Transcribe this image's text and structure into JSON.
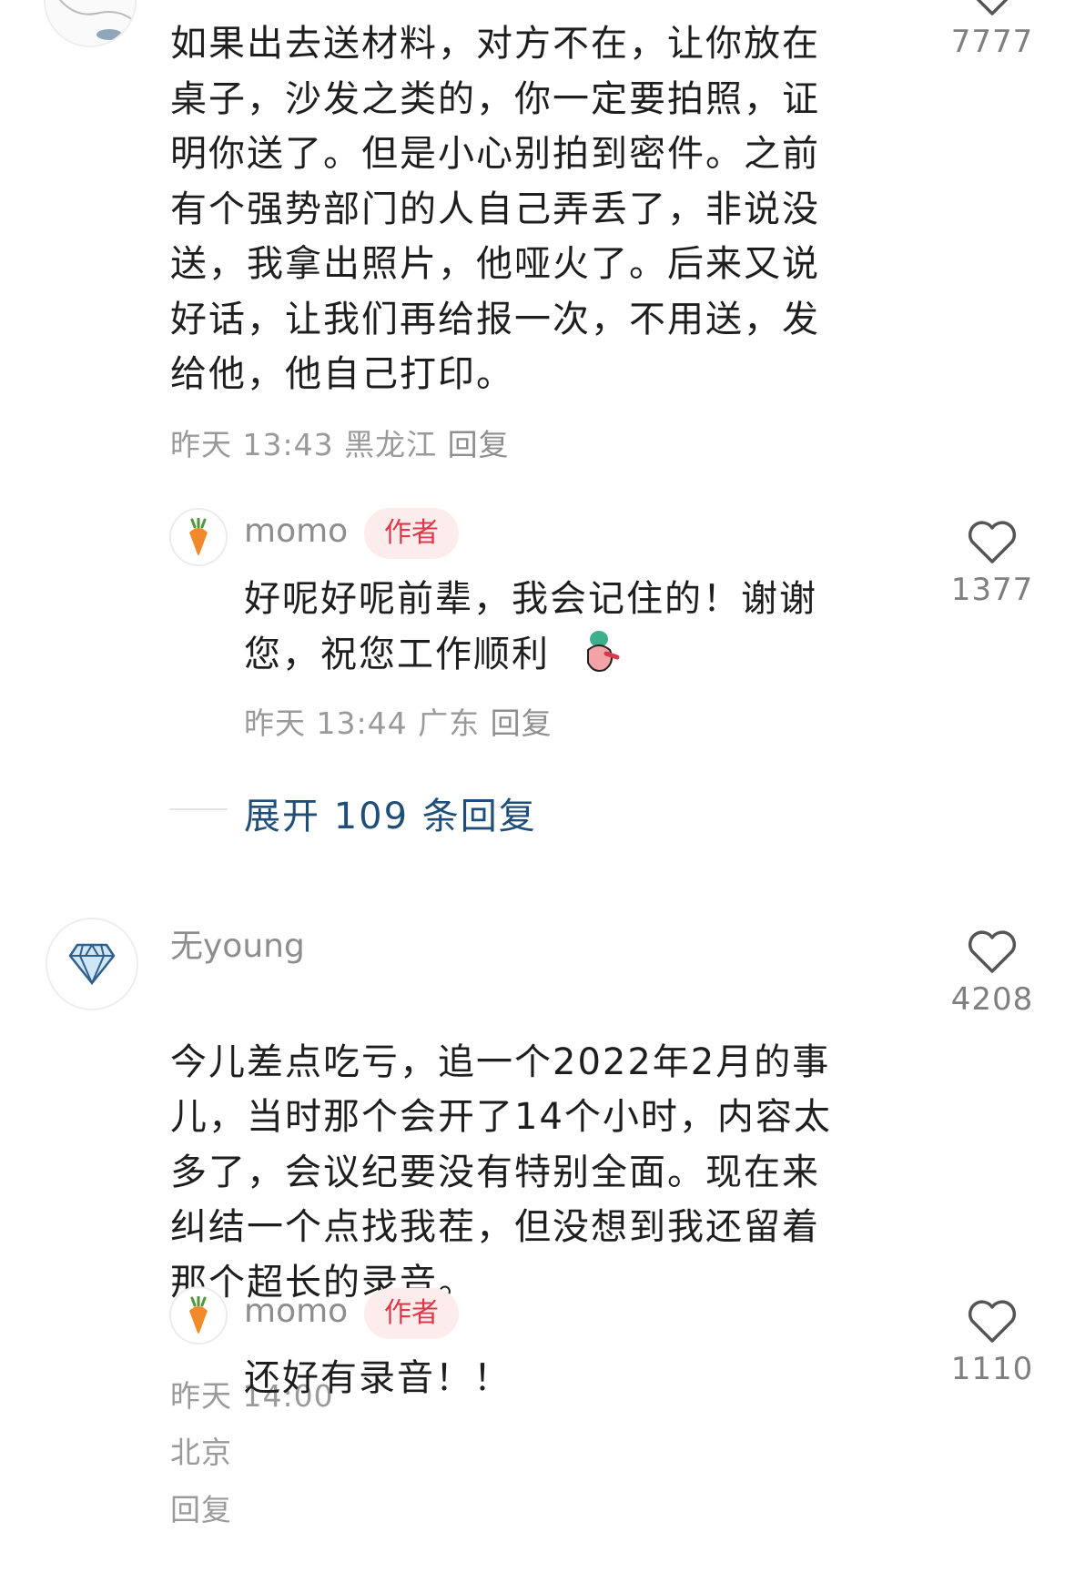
{
  "comment1": {
    "text": "如果出去送材料，对方不在，让你放在\n桌子，沙发之类的，你一定要拍照，证\n明你送了。但是小心别拍到密件。之前\n有个强势部门的人自己弄丢了，非说没\n送，我拿出照片，他哑火了。后来又说\n好话，让我们再给报一次，不用送，发\n给他，他自己打印。",
    "time": "昨天 13:43",
    "location": "黑龙江",
    "reply_label": "回复",
    "likes": "7777"
  },
  "reply1": {
    "username": "momo",
    "badge": "作者",
    "text": "好呢好呢前辈，我会记住的！谢谢\n您，祝您工作顺利",
    "time": "昨天 13:44",
    "location": "广东",
    "reply_label": "回复",
    "likes": "1377"
  },
  "expand": {
    "label": "展开 109 条回复"
  },
  "comment2": {
    "username": "无young",
    "text": "今儿差点吃亏，追一个2022年2月的事\n儿，当时那个会开了14个小时，内容太\n多了，会议纪要没有特别全面。现在来\n纠结一个点找我茬，但没想到我还留着\n那个超长的录音。",
    "time": "昨天 14:00",
    "location": "北京",
    "reply_label": "回复",
    "likes": "4208"
  },
  "reply2": {
    "username": "momo",
    "badge": "作者",
    "text": "还好有录音！！",
    "likes": "1110"
  },
  "colors": {
    "author_badge": "#e0384a",
    "expand_link": "#1f4e79"
  },
  "icons": [
    "heart-outline-icon",
    "carrot-avatar",
    "diamond-avatar",
    "cat-sketch-avatar"
  ]
}
